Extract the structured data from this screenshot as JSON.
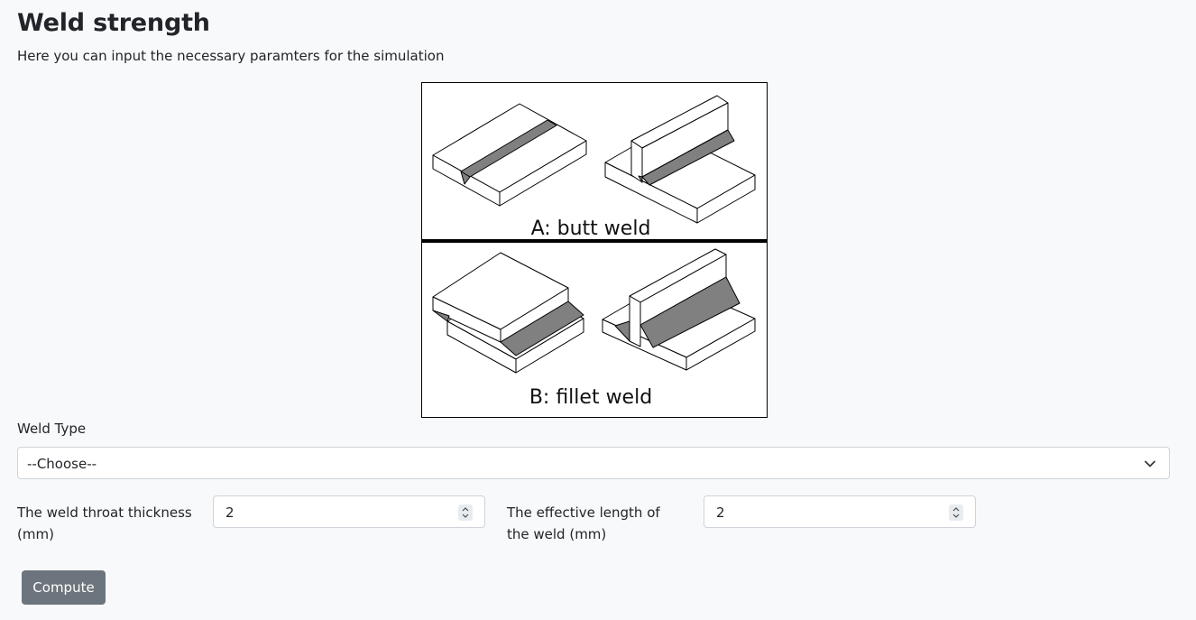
{
  "header": {
    "title": "Weld strength",
    "subtitle": "Here you can input the necessary paramters for the simulation"
  },
  "figure": {
    "label_a": "A: butt weld",
    "label_b": "B: fillet weld"
  },
  "weld_type": {
    "label": "Weld Type",
    "selected": "--Choose--"
  },
  "throat": {
    "label_line1": "The weld throat thickness",
    "label_line2": "(mm)",
    "value": "2"
  },
  "length": {
    "label_line1": "The effective length of",
    "label_line2": "the weld (mm)",
    "value": "2"
  },
  "actions": {
    "compute_label": "Compute"
  },
  "colors": {
    "background": "#f8f9fa",
    "button": "#6c757d",
    "weld_fill": "#808080"
  },
  "icons": {
    "select_chevron": "chevron-down-icon",
    "spinner": "up-down-spinner-icon"
  }
}
